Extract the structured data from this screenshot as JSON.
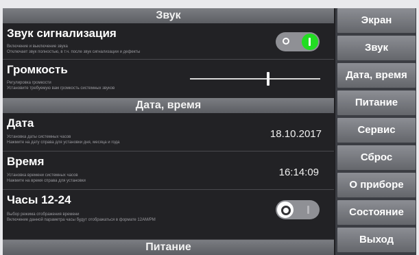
{
  "sections": {
    "sound": "Звук",
    "datetime": "Дата, время",
    "power": "Питание"
  },
  "rows": {
    "alarm_sound": {
      "title": "Звук сигнализация",
      "desc1": "Включение и выключение звука",
      "desc2": "Отключает звук полностью, в т.ч. после звук сигнализации и дефекты",
      "state": "on",
      "off_glyph": "O",
      "on_glyph": "I"
    },
    "volume": {
      "title": "Громкость",
      "desc1": "Регулировка громкости",
      "desc2": "Установите требуемую вам громкость системных звуков",
      "level": 0.6
    },
    "date": {
      "title": "Дата",
      "desc1": "Установка даты системных часов",
      "desc2": "Нажмите на дату справа для установки дня, месяца и года",
      "value": "18.10.2017"
    },
    "time": {
      "title": "Время",
      "desc1": "Установка времени системных часов",
      "desc2": "Нажмите на время справа для установки",
      "value": "16:14:09"
    },
    "clock_format": {
      "title": "Часы 12-24",
      "desc1": "Выбор режима отображения времени",
      "desc2": "Включение данной параметра часы будут отображаться в формате 12AM/PM",
      "state": "off",
      "off_glyph": "O",
      "on_glyph": "I"
    }
  },
  "nav": [
    "Экран",
    "Звук",
    "Дата, время",
    "Питание",
    "Сервис",
    "Сброс",
    "О приборе",
    "Состояние",
    "Выход"
  ],
  "colors": {
    "toggle_on": "#22dd22",
    "toggle_off_track": "#8f9095",
    "panel_bg": "#1f1f22",
    "header_bg": "#6b6d72",
    "nav_bg": "#7a7c82"
  }
}
